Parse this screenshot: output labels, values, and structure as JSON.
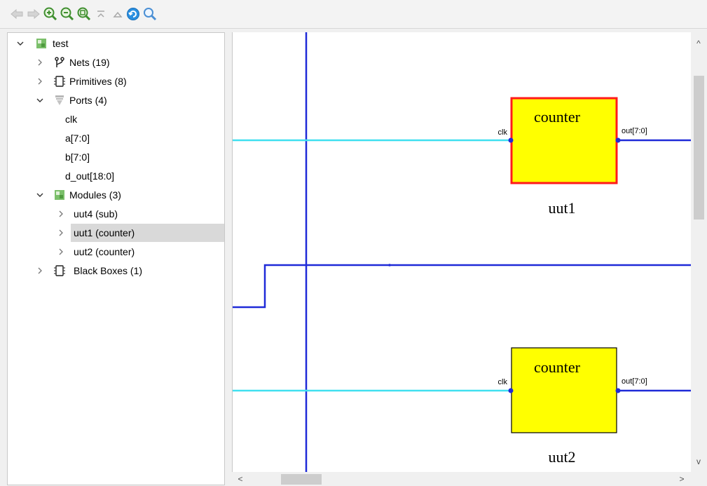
{
  "toolbar": {
    "buttons": [
      {
        "name": "back-icon",
        "enabled": false
      },
      {
        "name": "forward-icon",
        "enabled": false
      },
      {
        "name": "zoom-in-icon",
        "enabled": true
      },
      {
        "name": "zoom-out-icon",
        "enabled": true
      },
      {
        "name": "zoom-fit-icon",
        "enabled": true
      },
      {
        "name": "collapse-all-icon",
        "enabled": false
      },
      {
        "name": "expand-up-icon",
        "enabled": false
      },
      {
        "name": "refresh-icon",
        "enabled": true
      },
      {
        "name": "search-icon",
        "enabled": true
      }
    ]
  },
  "tree": {
    "root": {
      "label": "test",
      "expanded": true
    },
    "nets": {
      "label": "Nets (19)",
      "expanded": false
    },
    "primitives": {
      "label": "Primitives (8)",
      "expanded": false
    },
    "ports": {
      "label": "Ports (4)",
      "expanded": true,
      "items": [
        "clk",
        "a[7:0]",
        "b[7:0]",
        "d_out[18:0]"
      ]
    },
    "modules": {
      "label": "Modules (3)",
      "expanded": true,
      "items": [
        {
          "label": "uut4 (sub)",
          "selected": false
        },
        {
          "label": "uut1 (counter)",
          "selected": true
        },
        {
          "label": "uut2 (counter)",
          "selected": false
        }
      ]
    },
    "black_boxes": {
      "label": "Black Boxes (1)",
      "expanded": false
    }
  },
  "schematic": {
    "instances": [
      {
        "type_label": "counter",
        "instance_label": "uut1",
        "input_pin": "clk",
        "output_pin": "out[7:0]",
        "highlighted": true
      },
      {
        "type_label": "counter",
        "instance_label": "uut2",
        "input_pin": "clk",
        "output_pin": "out[7:0]",
        "highlighted": false
      }
    ],
    "colors": {
      "bus_wire": "#1f2ad8",
      "clk_wire": "#40e0f0",
      "block_fill": "#ffff00",
      "highlight_border": "#ff1a1a",
      "block_border": "#000000"
    }
  },
  "scrollbars": {
    "up_arrow": "^",
    "down_arrow": "v",
    "left_arrow": "<",
    "right_arrow": ">"
  }
}
